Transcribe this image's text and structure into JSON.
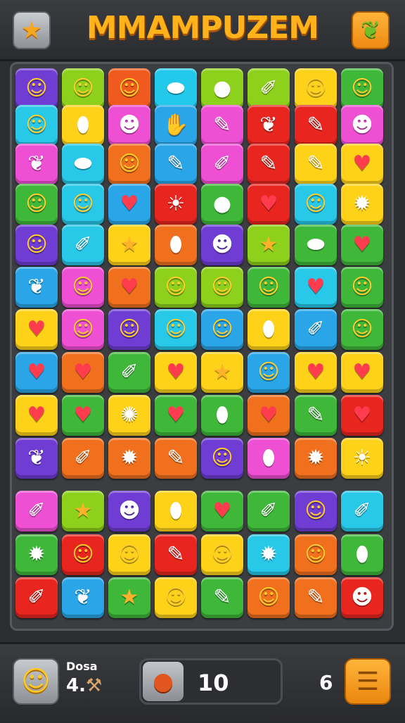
{
  "header": {
    "title": "MMAMPUZEM",
    "left_icon": "star-icon",
    "right_icon": "leaf-icon"
  },
  "icon_glyphs": {
    "face": "☺",
    "heart": "♥",
    "star": "★",
    "pencil": "✎",
    "leaf": "❦",
    "blob": "✹",
    "crayon": "✐",
    "bean": "⬮",
    "sun": "☀",
    "ghost": "☻",
    "hand": "✋",
    "fruit": "●",
    "drop": "⬬",
    "splat": "✺"
  },
  "board": {
    "rows": [
      [
        [
          "#6f3cd4",
          "face"
        ],
        [
          "#8ed11c",
          "face"
        ],
        [
          "#f05a1e",
          "face"
        ],
        [
          "#23c9ea",
          "drop"
        ],
        [
          "#8ed11c",
          "fruit"
        ],
        [
          "#8ed11c",
          "crayon"
        ],
        [
          "#ffd21a",
          "face"
        ],
        [
          "#3fb83a",
          "face"
        ]
      ],
      [
        [
          "#28c8e8",
          "face"
        ],
        [
          "#ffd21a",
          "bean"
        ],
        [
          "#ee4fd3",
          "ghost"
        ],
        [
          "#2aa6e8",
          "hand"
        ],
        [
          "#ee4fd3",
          "pencil"
        ],
        [
          "#e8261f",
          "leaf"
        ],
        [
          "#e8261f",
          "pencil"
        ],
        [
          "#ee4fd3",
          "ghost"
        ]
      ],
      [
        [
          "#ee4fd3",
          "leaf"
        ],
        [
          "#28c8e8",
          "drop"
        ],
        [
          "#f0701e",
          "face"
        ],
        [
          "#2aa6e8",
          "pencil"
        ],
        [
          "#ee4fd3",
          "crayon"
        ],
        [
          "#e8261f",
          "pencil"
        ],
        [
          "#ffd21a",
          "pencil"
        ],
        [
          "#ffd21a",
          "heart"
        ]
      ],
      [
        [
          "#3fb83a",
          "face"
        ],
        [
          "#28c8e8",
          "face"
        ],
        [
          "#2aa6e8",
          "heart"
        ],
        [
          "#e8261f",
          "sun"
        ],
        [
          "#3fb83a",
          "fruit"
        ],
        [
          "#e8261f",
          "heart"
        ],
        [
          "#28c8e8",
          "face"
        ],
        [
          "#ffd21a",
          "blob"
        ]
      ],
      [
        [
          "#6f3cd4",
          "face"
        ],
        [
          "#28c8e8",
          "crayon"
        ],
        [
          "#ffd21a",
          "star"
        ],
        [
          "#f0701e",
          "bean"
        ],
        [
          "#6f3cd4",
          "ghost"
        ],
        [
          "#8ed11c",
          "star"
        ],
        [
          "#3fb83a",
          "drop"
        ],
        [
          "#3fb83a",
          "heart"
        ]
      ],
      [
        [
          "#2aa6e8",
          "leaf"
        ],
        [
          "#ee4fd3",
          "face"
        ],
        [
          "#f0701e",
          "heart"
        ],
        [
          "#8ed11c",
          "face"
        ],
        [
          "#8ed11c",
          "face"
        ],
        [
          "#3fb83a",
          "face"
        ],
        [
          "#28c8e8",
          "heart"
        ],
        [
          "#3fb83a",
          "face"
        ]
      ],
      [
        [
          "#ffd21a",
          "heart"
        ],
        [
          "#ee4fd3",
          "face"
        ],
        [
          "#6f3cd4",
          "face"
        ],
        [
          "#28c8e8",
          "face"
        ],
        [
          "#2aa6e8",
          "face"
        ],
        [
          "#ffd21a",
          "bean"
        ],
        [
          "#2aa6e8",
          "crayon"
        ],
        [
          "#3fb83a",
          "face"
        ]
      ],
      [
        [
          "#2aa6e8",
          "heart"
        ],
        [
          "#f0701e",
          "heart"
        ],
        [
          "#3fb83a",
          "crayon"
        ],
        [
          "#ffd21a",
          "heart"
        ],
        [
          "#ffd21a",
          "star"
        ],
        [
          "#2aa6e8",
          "face"
        ],
        [
          "#ffd21a",
          "heart"
        ],
        [
          "#ffd21a",
          "heart"
        ]
      ],
      [
        [
          "#ffd21a",
          "heart"
        ],
        [
          "#3fb83a",
          "heart"
        ],
        [
          "#ffd21a",
          "splat"
        ],
        [
          "#3fb83a",
          "heart"
        ],
        [
          "#3fb83a",
          "bean"
        ],
        [
          "#f0701e",
          "heart"
        ],
        [
          "#3fb83a",
          "pencil"
        ],
        [
          "#e8261f",
          "heart"
        ]
      ],
      [
        [
          "#6f3cd4",
          "leaf"
        ],
        [
          "#f0701e",
          "crayon"
        ],
        [
          "#f0701e",
          "blob"
        ],
        [
          "#f0701e",
          "pencil"
        ],
        [
          "#6f3cd4",
          "face"
        ],
        [
          "#ee4fd3",
          "bean"
        ],
        [
          "#f0701e",
          "blob"
        ],
        [
          "#ffd21a",
          "sun"
        ]
      ],
      [
        [
          "#ee4fd3",
          "crayon"
        ],
        [
          "#8ed11c",
          "star"
        ],
        [
          "#6f3cd4",
          "ghost"
        ],
        [
          "#ffd21a",
          "bean"
        ],
        [
          "#3fb83a",
          "heart"
        ],
        [
          "#3fb83a",
          "crayon"
        ],
        [
          "#6f3cd4",
          "face"
        ],
        [
          "#28c8e8",
          "crayon"
        ]
      ],
      [
        [
          "#3fb83a",
          "blob"
        ],
        [
          "#e8261f",
          "face"
        ],
        [
          "#ffd21a",
          "face"
        ],
        [
          "#e8261f",
          "pencil"
        ],
        [
          "#ffd21a",
          "face"
        ],
        [
          "#28c8e8",
          "blob"
        ],
        [
          "#f0701e",
          "face"
        ],
        [
          "#3fb83a",
          "bean"
        ]
      ],
      [
        [
          "#e8261f",
          "crayon"
        ],
        [
          "#2aa6e8",
          "leaf"
        ],
        [
          "#3fb83a",
          "star"
        ],
        [
          "#ffd21a",
          "face"
        ],
        [
          "#3fb83a",
          "pencil"
        ],
        [
          "#f0701e",
          "face"
        ],
        [
          "#f0701e",
          "pencil"
        ],
        [
          "#e8261f",
          "ghost"
        ]
      ]
    ]
  },
  "footer": {
    "label": "Dosa",
    "value": "4.",
    "meter_value": "10",
    "level": "6",
    "avatar_icon": "face-icon",
    "hammer_icon": "hammer-icon",
    "meter_icon": "fruit-icon",
    "menu_icon": "menu-icon"
  }
}
